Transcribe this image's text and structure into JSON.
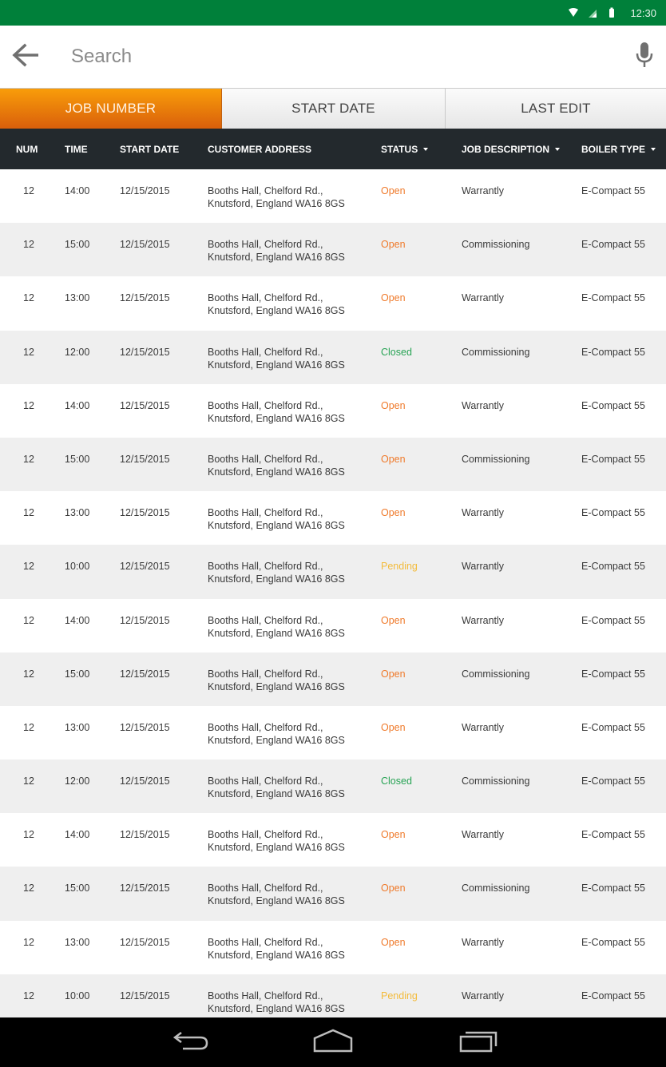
{
  "status_bar": {
    "time": "12:30",
    "icons": [
      "wifi-icon",
      "cell-signal-icon",
      "battery-icon"
    ]
  },
  "search": {
    "placeholder": "Search",
    "value": "",
    "back_icon": "arrow-left-icon",
    "mic_icon": "microphone-icon"
  },
  "sort_tabs": [
    {
      "label": "JOB NUMBER",
      "active": true
    },
    {
      "label": "START DATE",
      "active": false
    },
    {
      "label": "LAST EDIT",
      "active": false
    }
  ],
  "table": {
    "columns": {
      "num": "NUM",
      "time": "TIME",
      "start_date": "START DATE",
      "customer_address": "CUSTOMER ADDRESS",
      "status": "STATUS",
      "job_description": "JOB DESCRIPTION",
      "boiler_type": "BOILER TYPE"
    },
    "status_colors": {
      "Open": "#ef7a2b",
      "Closed": "#27a354",
      "Pending": "#f3bb3b"
    },
    "rows": [
      {
        "num": "12",
        "time": "14:00",
        "start_date": "12/15/2015",
        "address_line1": "Booths Hall, Chelford Rd.,",
        "address_line2": "Knutsford, England WA16 8GS",
        "status": "Open",
        "job_description": "Warrantly",
        "boiler_type": "E-Compact 55"
      },
      {
        "num": "12",
        "time": "15:00",
        "start_date": "12/15/2015",
        "address_line1": "Booths Hall, Chelford Rd.,",
        "address_line2": "Knutsford, England WA16 8GS",
        "status": "Open",
        "job_description": "Commissioning",
        "boiler_type": "E-Compact 55"
      },
      {
        "num": "12",
        "time": "13:00",
        "start_date": "12/15/2015",
        "address_line1": "Booths Hall, Chelford Rd.,",
        "address_line2": "Knutsford, England WA16 8GS",
        "status": "Open",
        "job_description": "Warrantly",
        "boiler_type": "E-Compact 55"
      },
      {
        "num": "12",
        "time": "12:00",
        "start_date": "12/15/2015",
        "address_line1": "Booths Hall, Chelford Rd.,",
        "address_line2": "Knutsford, England WA16 8GS",
        "status": "Closed",
        "job_description": "Commissioning",
        "boiler_type": "E-Compact 55"
      },
      {
        "num": "12",
        "time": "14:00",
        "start_date": "12/15/2015",
        "address_line1": "Booths Hall, Chelford Rd.,",
        "address_line2": "Knutsford, England WA16 8GS",
        "status": "Open",
        "job_description": "Warrantly",
        "boiler_type": "E-Compact 55"
      },
      {
        "num": "12",
        "time": "15:00",
        "start_date": "12/15/2015",
        "address_line1": "Booths Hall, Chelford Rd.,",
        "address_line2": "Knutsford, England WA16 8GS",
        "status": "Open",
        "job_description": "Commissioning",
        "boiler_type": "E-Compact 55"
      },
      {
        "num": "12",
        "time": "13:00",
        "start_date": "12/15/2015",
        "address_line1": "Booths Hall, Chelford Rd.,",
        "address_line2": "Knutsford, England WA16 8GS",
        "status": "Open",
        "job_description": "Warrantly",
        "boiler_type": "E-Compact 55"
      },
      {
        "num": "12",
        "time": "10:00",
        "start_date": "12/15/2015",
        "address_line1": "Booths Hall, Chelford Rd.,",
        "address_line2": "Knutsford, England WA16 8GS",
        "status": "Pending",
        "job_description": "Warrantly",
        "boiler_type": "E-Compact 55"
      },
      {
        "num": "12",
        "time": "14:00",
        "start_date": "12/15/2015",
        "address_line1": "Booths Hall, Chelford Rd.,",
        "address_line2": "Knutsford, England WA16 8GS",
        "status": "Open",
        "job_description": "Warrantly",
        "boiler_type": "E-Compact 55"
      },
      {
        "num": "12",
        "time": "15:00",
        "start_date": "12/15/2015",
        "address_line1": "Booths Hall, Chelford Rd.,",
        "address_line2": "Knutsford, England WA16 8GS",
        "status": "Open",
        "job_description": "Commissioning",
        "boiler_type": "E-Compact 55"
      },
      {
        "num": "12",
        "time": "13:00",
        "start_date": "12/15/2015",
        "address_line1": "Booths Hall, Chelford Rd.,",
        "address_line2": "Knutsford, England WA16 8GS",
        "status": "Open",
        "job_description": "Warrantly",
        "boiler_type": "E-Compact 55"
      },
      {
        "num": "12",
        "time": "12:00",
        "start_date": "12/15/2015",
        "address_line1": "Booths Hall, Chelford Rd.,",
        "address_line2": "Knutsford, England WA16 8GS",
        "status": "Closed",
        "job_description": "Commissioning",
        "boiler_type": "E-Compact 55"
      },
      {
        "num": "12",
        "time": "14:00",
        "start_date": "12/15/2015",
        "address_line1": "Booths Hall, Chelford Rd.,",
        "address_line2": "Knutsford, England WA16 8GS",
        "status": "Open",
        "job_description": "Warrantly",
        "boiler_type": "E-Compact 55"
      },
      {
        "num": "12",
        "time": "15:00",
        "start_date": "12/15/2015",
        "address_line1": "Booths Hall, Chelford Rd.,",
        "address_line2": "Knutsford, England WA16 8GS",
        "status": "Open",
        "job_description": "Commissioning",
        "boiler_type": "E-Compact 55"
      },
      {
        "num": "12",
        "time": "13:00",
        "start_date": "12/15/2015",
        "address_line1": "Booths Hall, Chelford Rd.,",
        "address_line2": "Knutsford, England WA16 8GS",
        "status": "Open",
        "job_description": "Warrantly",
        "boiler_type": "E-Compact 55"
      },
      {
        "num": "12",
        "time": "10:00",
        "start_date": "12/15/2015",
        "address_line1": "Booths Hall, Chelford Rd.,",
        "address_line2": "Knutsford, England WA16 8GS",
        "status": "Pending",
        "job_description": "Warrantly",
        "boiler_type": "E-Compact 55"
      }
    ]
  },
  "nav_bar": {
    "icons": [
      "back-nav-icon",
      "home-nav-icon",
      "recent-apps-icon"
    ]
  }
}
